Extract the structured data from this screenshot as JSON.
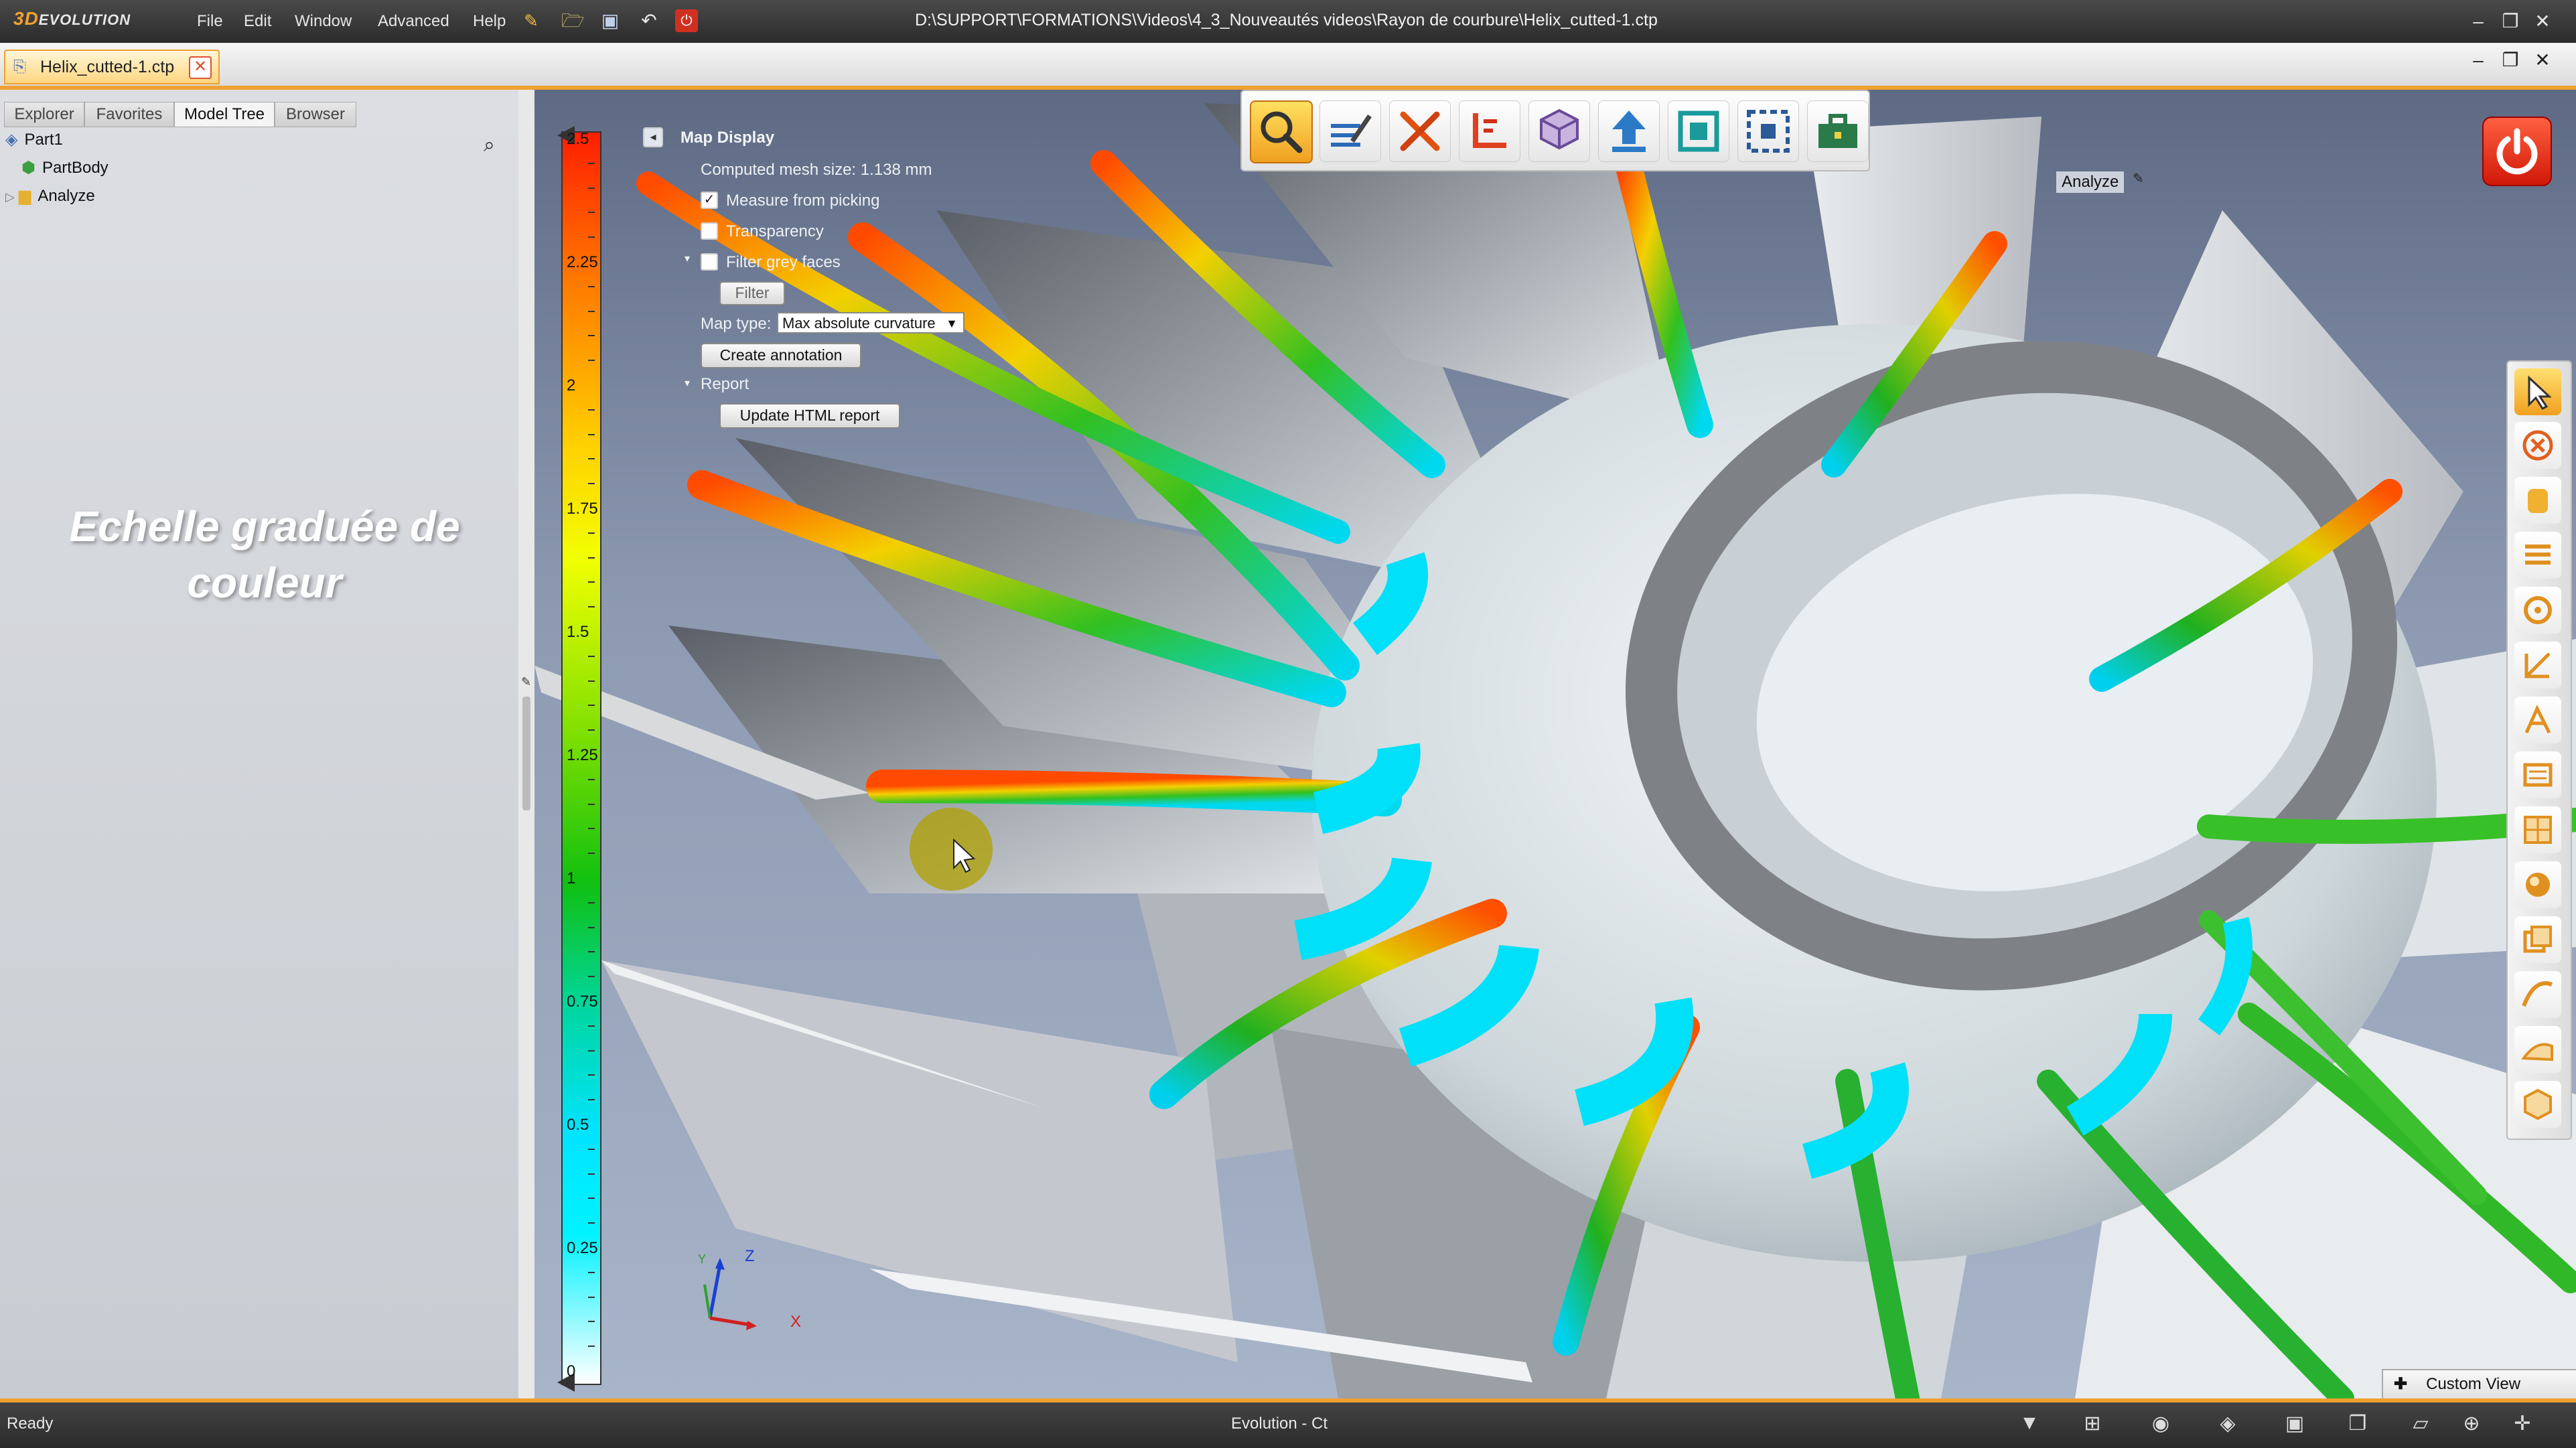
{
  "app": {
    "logo_3d": "3D",
    "logo_name": "EVOLUTION",
    "window_title": "D:\\SUPPORT\\FORMATIONS\\Videos\\4_3_Nouveautés videos\\Rayon de courbure\\Helix_cutted-1.ctp"
  },
  "menu": [
    "File",
    "Edit",
    "Window",
    "Advanced",
    "Help"
  ],
  "document_tab": {
    "label": "Helix_cutted-1.ctp"
  },
  "left_panel": {
    "tabs": [
      "Explorer",
      "Favorites",
      "Model Tree",
      "Browser"
    ],
    "active_tab": "Model Tree",
    "tree": [
      {
        "label": "Part1",
        "icon": "part-icon"
      },
      {
        "label": "PartBody",
        "icon": "partbody-icon"
      },
      {
        "label": "Analyze",
        "icon": "folder-icon"
      }
    ],
    "overlay_text_line1": "Echelle graduée de",
    "overlay_text_line2": "couleur"
  },
  "color_scale": {
    "labels": [
      "2.5",
      "2.25",
      "2",
      "1.75",
      "1.5",
      "1.25",
      "1",
      "0.75",
      "0.5",
      "0.25",
      "0"
    ],
    "top_color": "#ff1e00",
    "bottom_color": "#ffffff"
  },
  "map_display": {
    "title": "Map Display",
    "computed_mesh": "Computed mesh size: 1.138 mm",
    "measure_from_picking": {
      "label": "Measure from picking",
      "checked": true
    },
    "transparency": {
      "label": "Transparency",
      "checked": false
    },
    "filter_grey_faces": {
      "label": "Filter grey faces",
      "checked": false
    },
    "filter_button": "Filter",
    "map_type_label": "Map type:",
    "map_type_value": "Max absolute curvature",
    "create_annotation": "Create annotation",
    "report_label": "Report",
    "update_report": "Update HTML report"
  },
  "top_toolbar": {
    "buttons": [
      "analyze-icon",
      "annotate-icon",
      "tools-icon",
      "dimension-icon",
      "model-icon",
      "export-icon",
      "fit-icon",
      "mesh-icon",
      "toolbox-icon"
    ],
    "active_label": "Analyze"
  },
  "right_toolbar": {
    "buttons": [
      "select-icon",
      "cancel-icon",
      "hand-icon",
      "list-icon",
      "circle-icon",
      "measure-icon",
      "section-icon",
      "layer-icon",
      "grid-icon",
      "sphere-icon",
      "copy-icon",
      "curve-icon",
      "surface-icon",
      "solid-icon"
    ]
  },
  "viewport": {
    "custom_view": "Custom View",
    "axis": {
      "x": "X",
      "y": "Y",
      "z": "Z"
    }
  },
  "status_bar": {
    "left": "Ready",
    "center": "Evolution - Ct"
  },
  "colors": {
    "accent": "#f0a030",
    "power": "#e02810"
  }
}
